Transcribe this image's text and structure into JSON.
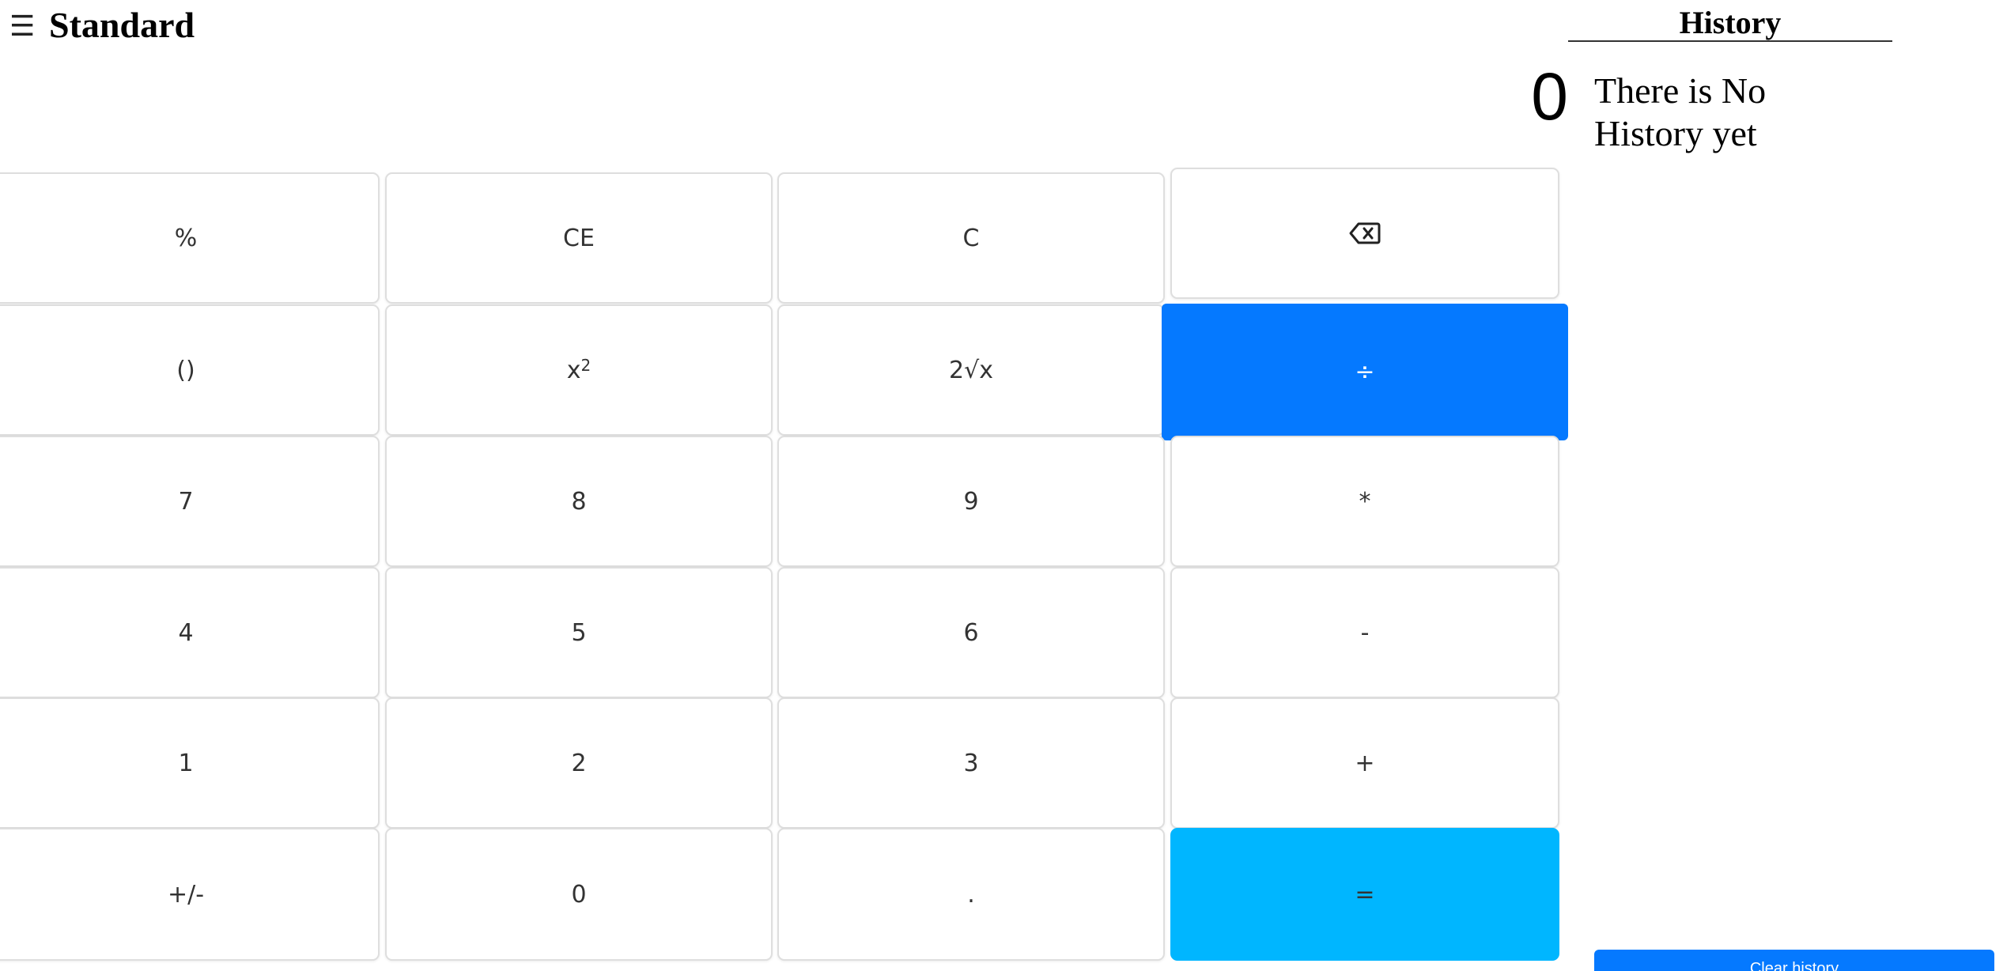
{
  "header": {
    "menu_icon": "hamburger-menu-icon",
    "mode_title": "Standard"
  },
  "display": {
    "value": "0"
  },
  "keypad": {
    "percent": "%",
    "clear_entry": "CE",
    "clear": "C",
    "backspace_icon": "backspace-icon",
    "parentheses": "()",
    "square_base": "x",
    "square_exp": "2",
    "sqrt": "2√x",
    "divide": "÷",
    "seven": "7",
    "eight": "8",
    "nine": "9",
    "multiply": "*",
    "four": "4",
    "five": "5",
    "six": "6",
    "minus": "-",
    "one": "1",
    "two": "2",
    "three": "3",
    "plus": "+",
    "negate": "+/-",
    "zero": "0",
    "decimal": ".",
    "equals": "="
  },
  "history": {
    "title": "History",
    "empty_message": "There is No History yet",
    "clear_button": "Clear history"
  },
  "colors": {
    "divide_button": "#0579ff",
    "equals_button": "#00b6ff",
    "clear_history_button": "#0579ff"
  }
}
